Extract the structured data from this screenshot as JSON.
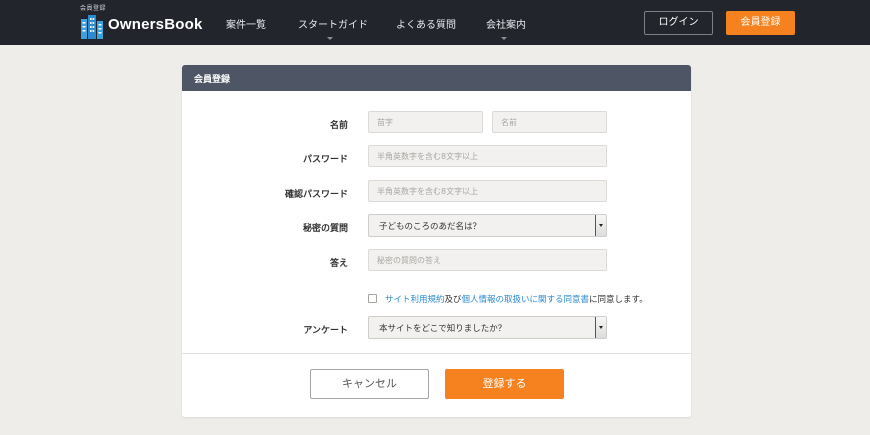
{
  "header": {
    "logo_tagline": "会員登録",
    "logo_text": "OwnersBook",
    "nav": [
      {
        "label": "案件一覧",
        "has_dropdown": false
      },
      {
        "label": "スタートガイド",
        "has_dropdown": true
      },
      {
        "label": "よくある質問",
        "has_dropdown": false
      },
      {
        "label": "会社案内",
        "has_dropdown": true
      }
    ],
    "login_label": "ログイン",
    "register_label": "会員登録"
  },
  "form": {
    "title": "会員登録",
    "name_label": "名前",
    "last_name_placeholder": "苗字",
    "first_name_placeholder": "名前",
    "password_label": "パスワード",
    "password_placeholder": "半角英数字を含む8文字以上",
    "confirm_password_label": "確認パスワード",
    "confirm_password_placeholder": "半角英数字を含む8文字以上",
    "secret_question_label": "秘密の質問",
    "secret_question_value": "子どものころのあだ名は？",
    "answer_label": "答え",
    "answer_placeholder": "秘密の質問の答え",
    "agreement": {
      "link1": "サイト利用規約",
      "middle": "及び",
      "link2": "個人情報の取扱いに関する同意書",
      "suffix": "に同意します。",
      "checked": false
    },
    "survey_label": "アンケート",
    "survey_value": "本サイトをどこで知りましたか？",
    "cancel_label": "キャンセル",
    "submit_label": "登録する"
  },
  "colors": {
    "header_bg": "#22252b",
    "accent_orange": "#f5821f",
    "card_header_bg": "#4e5564",
    "link_blue": "#2a8bd0",
    "page_bg": "#efedea"
  }
}
